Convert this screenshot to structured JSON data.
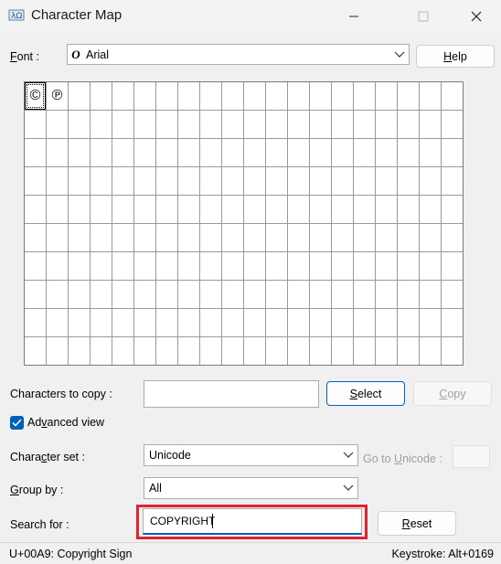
{
  "window": {
    "title": "Character Map",
    "app_icon": "charmap-app-icon",
    "controls": [
      "minimize-icon",
      "maximize-icon",
      "close-icon"
    ]
  },
  "font_row": {
    "label_access": "F",
    "label_rest": "ont :",
    "font_icon_glyph": "O",
    "selected_font": "Arial",
    "help_access": "H",
    "help_rest": "elp"
  },
  "grid": {
    "columns": 20,
    "rows": 10,
    "characters": [
      {
        "glyph": "©",
        "name": "Copyright Sign",
        "selected": true
      },
      {
        "glyph": "℗",
        "name": "Sound Recording Copyright",
        "selected": false
      }
    ]
  },
  "copy_row": {
    "label_pre": "Characters to copy :",
    "value": "",
    "select_access": "S",
    "select_rest": "elect",
    "copy_access": "C",
    "copy_rest": "opy"
  },
  "advanced": {
    "checked": true,
    "label_pre": "Ad",
    "label_access": "v",
    "label_rest": "anced view"
  },
  "character_set": {
    "label_pre": "Chara",
    "label_access": "c",
    "label_rest": "ter set :",
    "value": "Unicode",
    "goto_pre": "Go to ",
    "goto_access": "U",
    "goto_rest": "nicode :",
    "goto_value": ""
  },
  "group_by": {
    "label_access": "G",
    "label_rest": "roup by :",
    "value": "All"
  },
  "search": {
    "label_pre": "Search for :",
    "value": "COPYRIGHT",
    "reset_access": "R",
    "reset_rest": "eset",
    "highlight_color": "#e0232d"
  },
  "status": {
    "left": "U+00A9: Copyright Sign",
    "right": "Keystroke: Alt+0169"
  },
  "colors": {
    "accent": "#005fb8",
    "checkbox": "#005fb8"
  }
}
